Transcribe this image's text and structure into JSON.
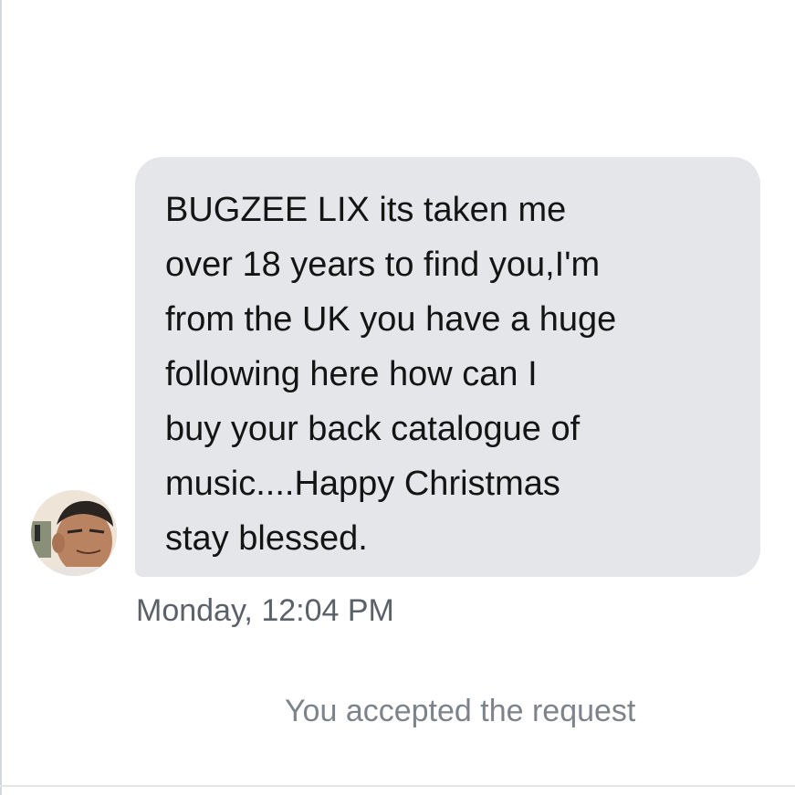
{
  "message": {
    "sender_avatar": "profile-photo",
    "text": "BUGZEE LIX its taken me\nover 18 years to find you,I'm\nfrom the UK you have a huge\nfollowing here how can I\nbuy your back catalogue of\nmusic....Happy Christmas\nstay blessed.",
    "timestamp": "Monday, 12:04 PM",
    "bubble_color": "#e4e6e9"
  },
  "system_note": {
    "text": "You accepted the request"
  },
  "colors": {
    "background": "#ffffff",
    "message_text": "#141414",
    "timestamp_text": "#5b6169",
    "note_text": "#7d838a"
  }
}
